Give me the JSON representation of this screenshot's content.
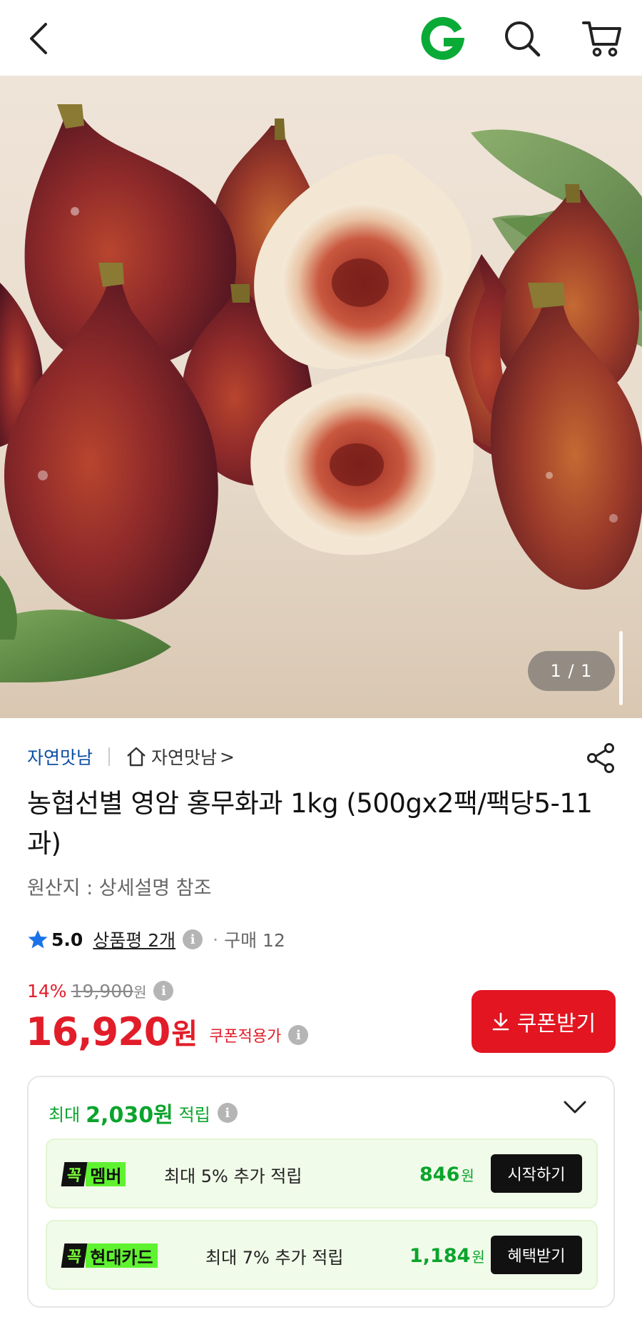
{
  "header": {
    "back_icon": "chevron-left-icon",
    "logo_letter": "G",
    "search_icon": "search-icon",
    "cart_icon": "cart-icon",
    "brand_color": "#0aaa37"
  },
  "gallery": {
    "counter": "1 / 1",
    "image_subject": "figs-photo"
  },
  "seller": {
    "name": "자연맛남",
    "store_label": "자연맛남",
    "store_arrow": ">"
  },
  "product": {
    "title": "농협선별 영암 홍무화과 1kg (500gx2팩/팩당5-11과)",
    "origin": "원산지 : 상세설명 참조"
  },
  "rating": {
    "score": "5.0",
    "reviews": "상품평 2개",
    "info": "i",
    "purchases": "구매 12"
  },
  "price": {
    "discount": "14%",
    "original": "19,900",
    "original_unit": "원",
    "info": "i",
    "sale": "16,920",
    "sale_unit": "원",
    "coupon_applied": "쿠폰적용가",
    "coupon_button": "쿠폰받기",
    "accent_color": "#e31521"
  },
  "reward": {
    "prefix": "최대",
    "amount": "2,030원",
    "suffix": "적립",
    "info": "i",
    "accent_color": "#0aa42c",
    "perks": [
      {
        "badge_mark": "꼭",
        "badge_label": "멤버",
        "desc": "최대 5% 추가 적립",
        "amount": "846",
        "unit": "원",
        "button": "시작하기"
      },
      {
        "badge_mark": "꼭",
        "badge_label": "현대카드",
        "desc": "최대 7% 추가 적립",
        "amount": "1,184",
        "unit": "원",
        "button": "혜택받기"
      }
    ]
  }
}
